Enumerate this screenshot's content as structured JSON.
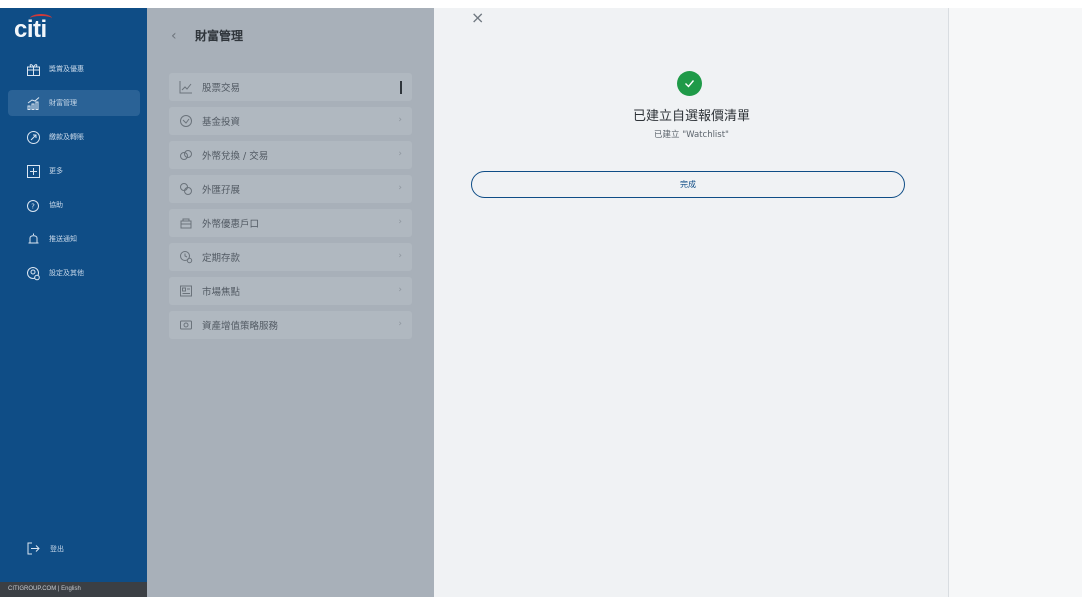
{
  "sidebar": {
    "logo": "citi",
    "items": [
      {
        "label": "獎賞及優惠",
        "icon": "gift-icon"
      },
      {
        "label": "財富管理",
        "icon": "growth-chart-icon"
      },
      {
        "label": "繳款及轉賬",
        "icon": "transfer-arrow-icon"
      },
      {
        "label": "更多",
        "icon": "plus-box-icon"
      },
      {
        "label": "協助",
        "icon": "question-icon"
      },
      {
        "label": "推送通知",
        "icon": "bell-icon"
      },
      {
        "label": "設定及其他",
        "icon": "settings-user-icon"
      }
    ],
    "logout": "登出",
    "footer": "CITIGROUP.COM  |  English"
  },
  "midpanel": {
    "title": "財富管理",
    "menu": [
      {
        "label": "股票交易",
        "icon": "stock-chart-icon",
        "selected": true
      },
      {
        "label": "基金投資",
        "icon": "fund-icon"
      },
      {
        "label": "外幣兌換 / 交易",
        "icon": "currency-exchange-icon"
      },
      {
        "label": "外匯孖展",
        "icon": "fx-margin-icon"
      },
      {
        "label": "外幣優惠戶口",
        "icon": "account-icon"
      },
      {
        "label": "定期存款",
        "icon": "time-deposit-icon"
      },
      {
        "label": "市場焦點",
        "icon": "news-icon"
      },
      {
        "label": "資產增值策略服務",
        "icon": "strategy-icon"
      }
    ]
  },
  "dialog": {
    "close": "×",
    "title": "已建立自選報價清單",
    "subtitle": "已建立 \"Watchlist\"",
    "done_button": "完成"
  },
  "colors": {
    "sidebar": "#0f4d86",
    "success": "#1f9a48",
    "accent": "#0f4d86"
  }
}
